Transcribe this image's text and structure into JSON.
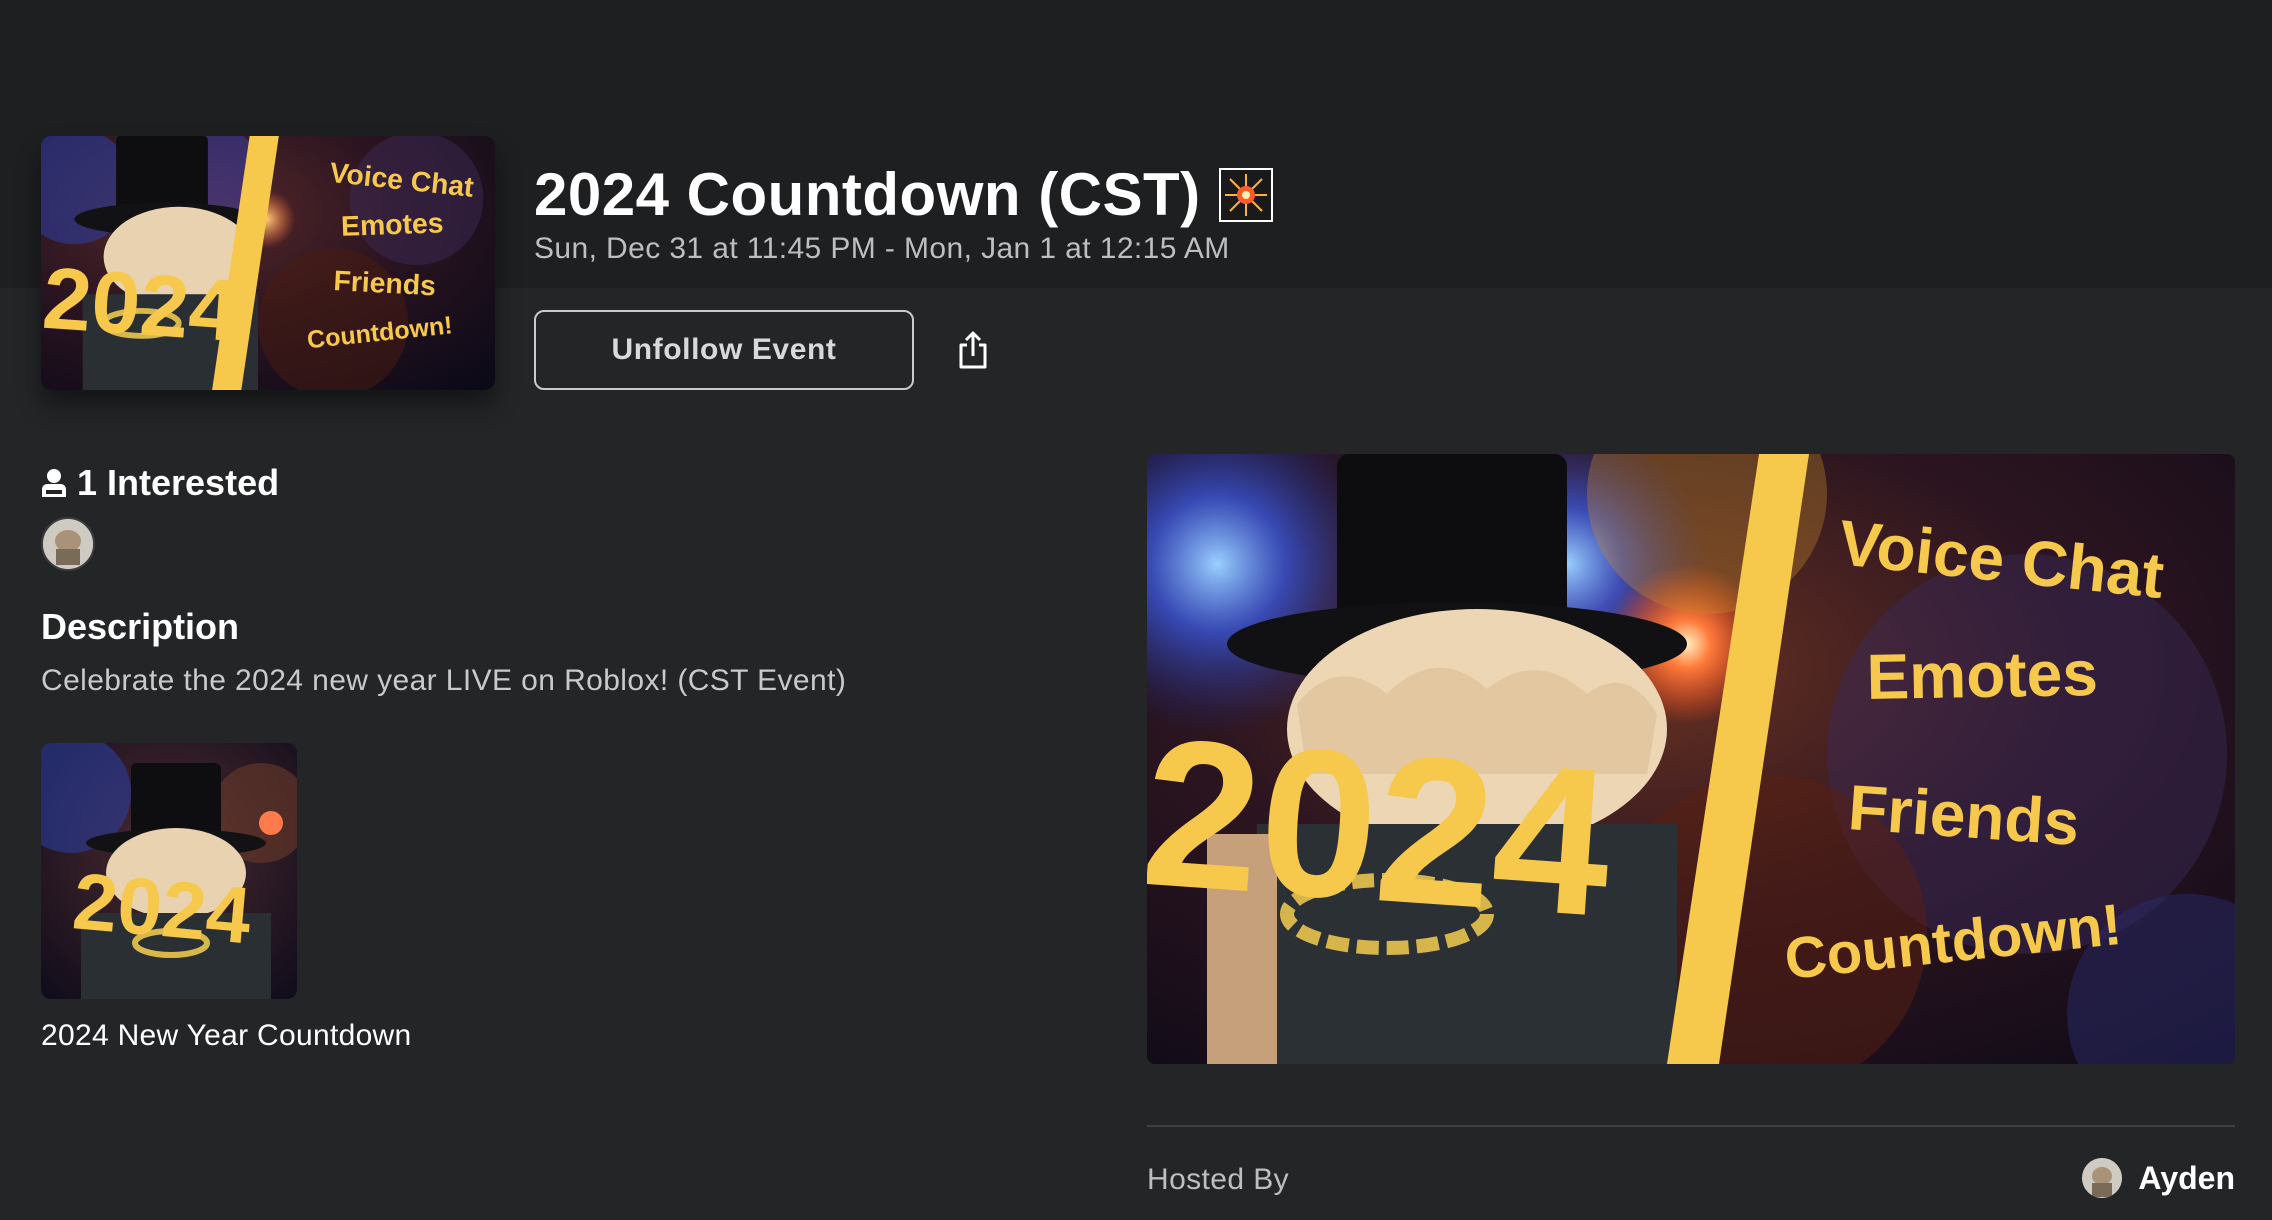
{
  "event": {
    "title": "2024 Countdown (CST)",
    "time_range": "Sun, Dec 31 at 11:45 PM - Mon, Jan 1 at 12:15 AM",
    "unfollow_label": "Unfollow Event",
    "share_icon": "share-icon",
    "title_emoji": "fireworks-icon"
  },
  "thumbnail_text": {
    "year": "2024",
    "line1": "Voice Chat",
    "line2": "Emotes",
    "line3": "Friends",
    "line4": "Countdown!"
  },
  "interested": {
    "label": "1 Interested",
    "icon": "person-icon"
  },
  "description": {
    "heading": "Description",
    "text": "Celebrate the 2024 new year LIVE on Roblox! (CST Event)"
  },
  "experience": {
    "name": "2024 New Year Countdown"
  },
  "host": {
    "label": "Hosted By",
    "name": "Ayden"
  },
  "colors": {
    "background": "#232527",
    "header_band": "#1e1f21",
    "accent_yellow": "#f6c84c",
    "muted_text": "#bdbec0"
  }
}
